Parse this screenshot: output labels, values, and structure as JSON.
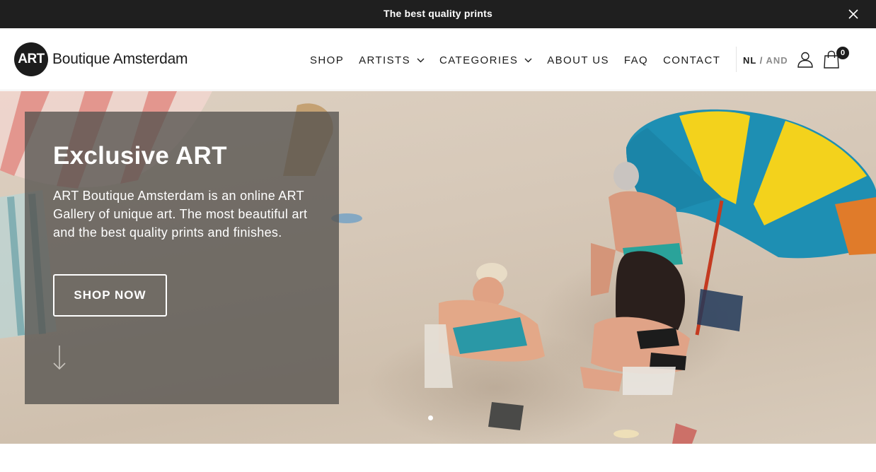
{
  "announcement": {
    "text": "The best quality prints"
  },
  "header": {
    "logo": {
      "mark": "ART",
      "text": "Boutique Amsterdam"
    },
    "nav": [
      {
        "label": "SHOP",
        "dropdown": false
      },
      {
        "label": "ARTISTS",
        "dropdown": true
      },
      {
        "label": "CATEGORIES",
        "dropdown": true
      },
      {
        "label": "ABOUT US",
        "dropdown": false
      },
      {
        "label": "FAQ",
        "dropdown": false
      },
      {
        "label": "CONTACT",
        "dropdown": false
      }
    ],
    "language": {
      "active": "NL",
      "separator": "/",
      "other": "AND"
    },
    "cart": {
      "count": "0"
    }
  },
  "hero": {
    "title": "Exclusive ART",
    "description": "ART Boutique Amsterdam is an online ART Gallery of unique art. The most beautiful art and the best quality prints and finishes.",
    "button_label": "SHOP NOW",
    "slides_total": 1,
    "slide_active": 1
  },
  "icons": {
    "close": "close-icon",
    "chevron": "chevron-down-icon",
    "user": "user-icon",
    "cart": "shopping-bag-icon",
    "scroll": "arrow-down-icon"
  },
  "colors": {
    "topbar_bg": "#1f1f1f",
    "text_dark": "#1c1c1c",
    "overlay": "#55524e",
    "umbrella_blue": "#1e8fb3",
    "umbrella_yellow": "#f3d21c"
  }
}
